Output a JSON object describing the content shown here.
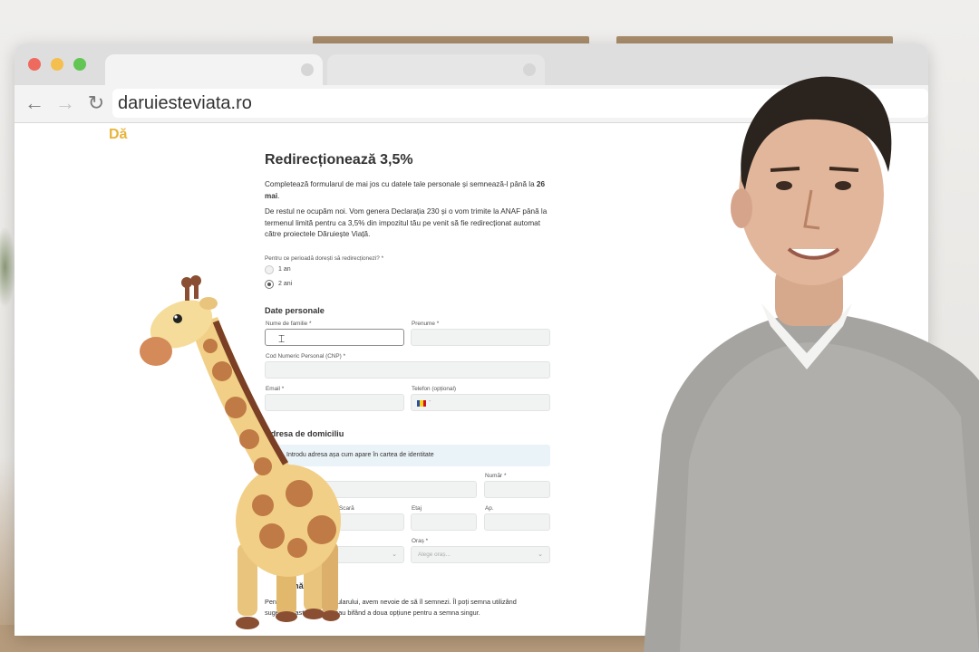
{
  "browser": {
    "url": "daruiesteviata.ro",
    "colors": {
      "close": "#ee6a5f",
      "minimize": "#f5bf4f",
      "maximize": "#62c554"
    },
    "icons": {
      "back": "arrow-left-icon",
      "forward": "arrow-right-icon",
      "reload": "reload-icon"
    }
  },
  "site": {
    "logo": "Dă",
    "title": "Redirecționează 3,5%",
    "intro_before": "Completează formularul de mai jos cu datele tale personale și semnează-l până la ",
    "intro_date": "26 mai",
    "intro_after": ".",
    "intro2": "De restul ne ocupăm noi. Vom genera Declarația 230 și o vom trimite la ANAF până la termenul limită pentru ca 3,5% din impozitul tău pe venit să fie redirecționat automat către proiectele Dăruiește Viață.",
    "period_question": "Pentru ce perioadă dorești să redirecționezi? *",
    "period_options": [
      "1 an",
      "2 ani"
    ],
    "period_selected": "2 ani",
    "personal_section": "Date personale",
    "fields": {
      "last_name": "Nume de familie *",
      "first_name": "Prenume *",
      "cnp": "Cod Numeric Personal (CNP) *",
      "email": "Email *",
      "phone": "Telefon (opțional)",
      "phone_prefix": "-"
    },
    "address_section": "Adresa de domiciliu",
    "address_info": "Introdu adresa așa cum apare în cartea de identitate",
    "address_fields": {
      "number": "Număr *",
      "staircase": "Scară",
      "floor": "Etaj",
      "apartment": "Ap.",
      "city": "Oraș *",
      "city_placeholder": "Alege oraș..."
    },
    "signature_section_partial": "nătură",
    "signature_line1a": "Pentru",
    "signature_line1b": "pletarea",
    "signature_line1c": "ularului, avem nevoie de să îl semnezi. Îl poți semna utilizând",
    "signature_line2a": "sugest",
    "signature_line2b": "astră de",
    "signature_line2c": "s sau bifând a doua opțiune pentru a semna singur."
  }
}
